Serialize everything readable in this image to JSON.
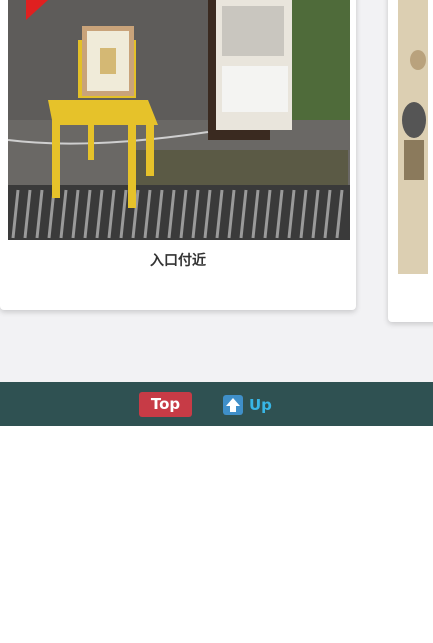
{
  "photo": {
    "caption": "入口付近"
  },
  "footer": {
    "top_label": "Top",
    "up_label": "Up",
    "up_icon": "arrow-up-icon",
    "colors": {
      "bar": "#2f5152",
      "top_button": "#c73b46",
      "up_text": "#38b6e6"
    }
  }
}
